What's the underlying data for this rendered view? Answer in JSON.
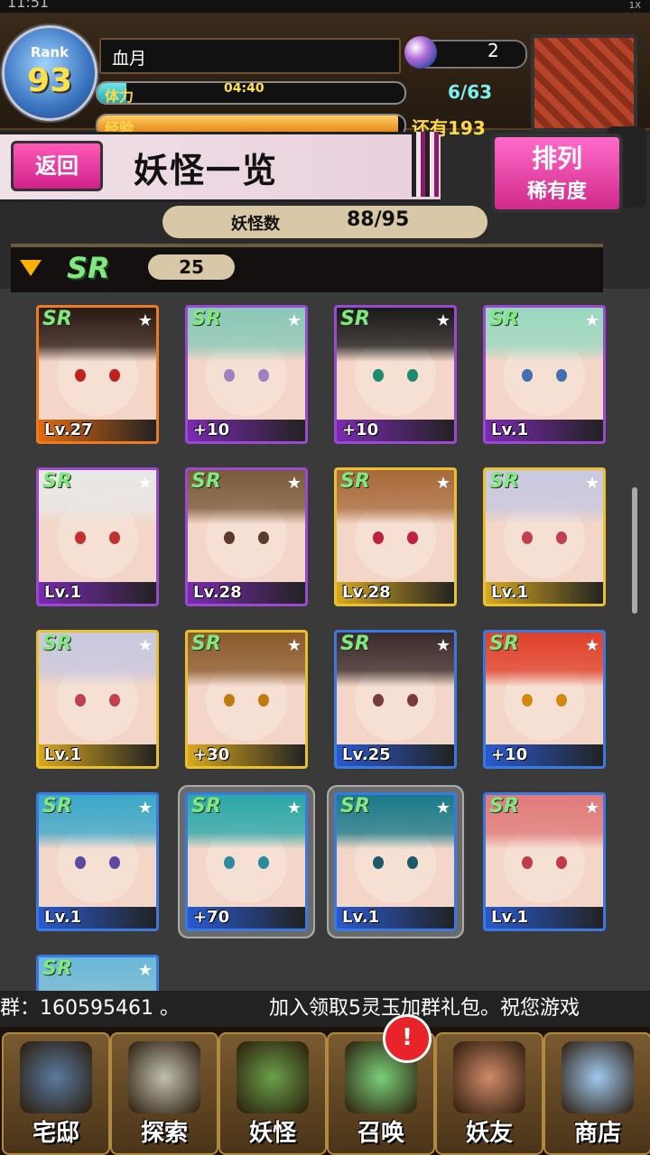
{
  "status": {
    "time": "11:51",
    "signal": "1X"
  },
  "player": {
    "rank_label": "Rank",
    "rank": "93",
    "name": "血月",
    "stamina_label": "体力",
    "stamina_timer": "04:40",
    "stamina_count": "6/63",
    "stamina_fraction": 0.095,
    "exp_label": "经验",
    "exp_remaining": "还有193",
    "exp_fraction": 0.98,
    "gems": "2"
  },
  "header": {
    "back_label": "返回",
    "title": "妖怪一览",
    "sort_label": "排列",
    "sort_value": "稀有度",
    "count_label": "妖怪数",
    "count_value": "88/95"
  },
  "section": {
    "rarity": "SR",
    "count": "25"
  },
  "cards": [
    {
      "badge": "SR",
      "level": "Lv.27",
      "frame": "orange",
      "hair": "#2a1a14",
      "eye": "#c02020"
    },
    {
      "badge": "SR",
      "level": "+10",
      "frame": "purple",
      "hair": "#8ac8b8",
      "eye": "#a080c0"
    },
    {
      "badge": "SR",
      "level": "+10",
      "frame": "purple",
      "hair": "#1a1a1a",
      "eye": "#1a8a70"
    },
    {
      "badge": "SR",
      "level": "Lv.1",
      "frame": "purple",
      "hair": "#9ad8c0",
      "eye": "#4070b0"
    },
    {
      "badge": "SR",
      "level": "Lv.1",
      "frame": "purple",
      "hair": "#e8e8e8",
      "eye": "#c03030"
    },
    {
      "badge": "SR",
      "level": "Lv.28",
      "frame": "purple",
      "hair": "#7a5a3a",
      "eye": "#5a3a2a"
    },
    {
      "badge": "SR",
      "level": "Lv.28",
      "frame": "gold",
      "hair": "#a86a3a",
      "eye": "#c02040"
    },
    {
      "badge": "SR",
      "level": "Lv.1",
      "frame": "gold",
      "hair": "#c8c8e0",
      "eye": "#c04050"
    },
    {
      "badge": "SR",
      "level": "Lv.1",
      "frame": "gold",
      "hair": "#c8c8e0",
      "eye": "#c04050"
    },
    {
      "badge": "SR",
      "level": "+30",
      "frame": "gold",
      "hair": "#8a5a2a",
      "eye": "#c07a10"
    },
    {
      "badge": "SR",
      "level": "Lv.25",
      "frame": "blue",
      "hair": "#3a2a2a",
      "eye": "#7a3a3a"
    },
    {
      "badge": "SR",
      "level": "+10",
      "frame": "blue",
      "hair": "#e0402a",
      "eye": "#d08a10"
    },
    {
      "badge": "SR",
      "level": "Lv.1",
      "frame": "blue",
      "hair": "#3aa8c8",
      "eye": "#5a4aa0"
    },
    {
      "badge": "SR",
      "level": "+70",
      "frame": "blue",
      "hair": "#2aa8a8",
      "eye": "#2a8aa0"
    },
    {
      "badge": "SR",
      "level": "Lv.1",
      "frame": "blue",
      "hair": "#1a7a8a",
      "eye": "#1a5a6a"
    },
    {
      "badge": "SR",
      "level": "Lv.1",
      "frame": "blue",
      "hair": "#e07a7a",
      "eye": "#c03a4a"
    },
    {
      "badge": "SR",
      "level": "",
      "frame": "blue",
      "hair": "#6ab8d8",
      "eye": "#4a6ab0"
    }
  ],
  "ticker": {
    "part1": "群：160595461 。",
    "part2": "加入领取5灵玉加群礼包。祝您游戏"
  },
  "nav": [
    {
      "label": "宅邸",
      "icon": "mansion-icon",
      "color": "#5a7aa0"
    },
    {
      "label": "探索",
      "icon": "magnifier-icon",
      "color": "#c0c0b0"
    },
    {
      "label": "妖怪",
      "icon": "scroll-icon",
      "color": "#6aa04a"
    },
    {
      "label": "召唤",
      "icon": "pentagram-icon",
      "color": "#7ad07a"
    },
    {
      "label": "妖友",
      "icon": "friend-icon",
      "color": "#d08a6a"
    },
    {
      "label": "商店",
      "icon": "orb-icon",
      "color": "#a0c8f0"
    }
  ],
  "alert": "!"
}
